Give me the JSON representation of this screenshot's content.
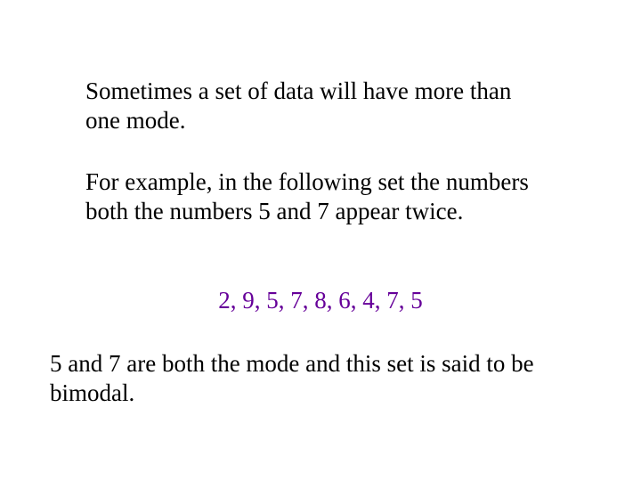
{
  "para1": "Sometimes a set of data will have more than one mode.",
  "para2": "For example, in the following set the numbers both the numbers 5 and 7 appear twice.",
  "data_line": "2, 9, 5, 7, 8, 6, 4, 7, 5",
  "para3": "5 and 7 are both the mode and this set is said to be bimodal."
}
